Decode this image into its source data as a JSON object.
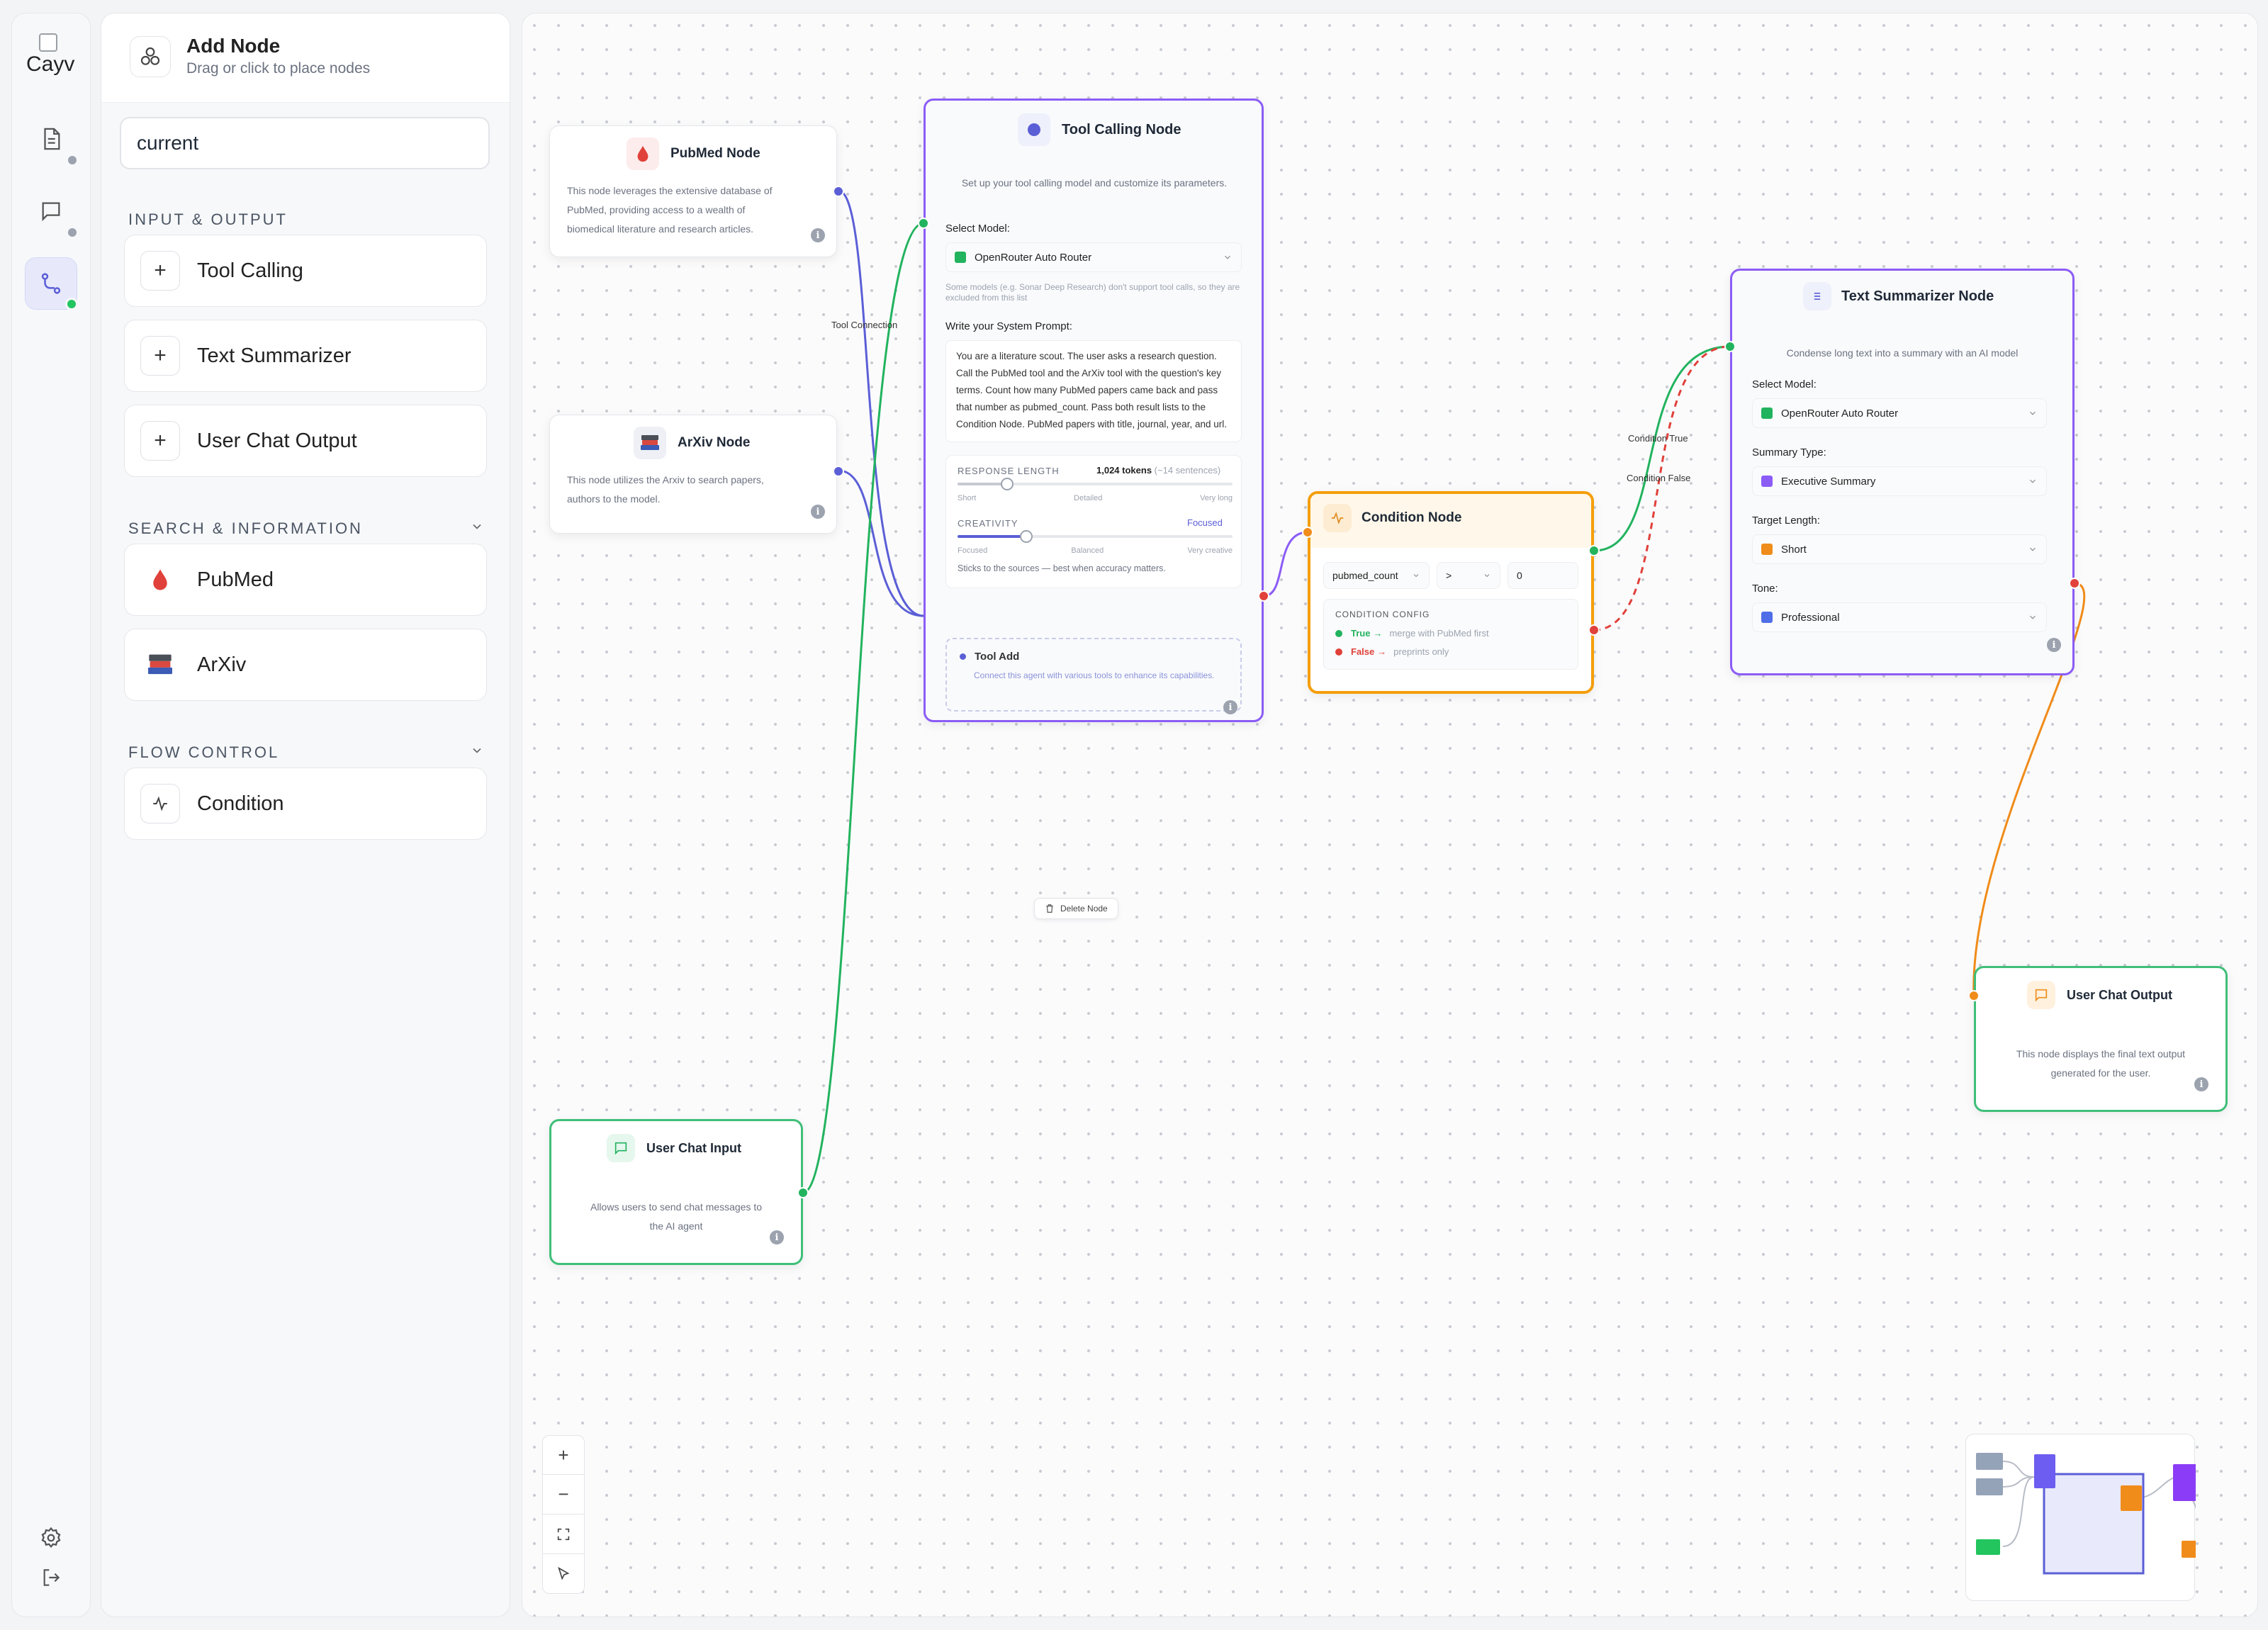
{
  "app": {
    "logo_text": "Cayv"
  },
  "panel": {
    "title": "Add Node",
    "subtitle": "Drag or click to place nodes",
    "search_value": "current",
    "sections": [
      {
        "label": "INPUT & OUTPUT",
        "items": [
          "Tool Calling",
          "Text Summarizer",
          "User Chat Output"
        ]
      },
      {
        "label": "SEARCH & INFORMATION",
        "items": [
          "PubMed",
          "ArXiv"
        ]
      },
      {
        "label": "FLOW CONTROL",
        "items": [
          "Condition"
        ]
      }
    ]
  },
  "nodes": {
    "pubmed": {
      "title": "PubMed Node",
      "desc": [
        "This node leverages the extensive database of",
        "PubMed, providing access to a wealth of",
        "biomedical literature and research articles."
      ]
    },
    "arxiv": {
      "title": "ArXiv Node",
      "desc": [
        "This node utilizes the Arxiv to search papers,",
        "authors to the model."
      ]
    },
    "tool": {
      "title": "Tool Calling Node",
      "subtitle": "Set up your tool calling model and customize its parameters.",
      "model_label": "Select Model:",
      "model_value": "OpenRouter Auto Router",
      "model_note": "Some models (e.g. Sonar Deep Research) don't support tool calls, so they are excluded from this list",
      "prompt_label": "Write your System Prompt:",
      "prompt_text": "You are a literature scout. The user asks a research question. Call the PubMed tool and the ArXiv tool with the question's key terms. Count how many PubMed papers came back and pass that number as pubmed_count. Pass both result lists to the Condition Node. PubMed papers with title, journal, year, and url.",
      "response_label": "RESPONSE LENGTH",
      "response_value": "1,024 tokens",
      "response_note": "(~14 sentences)",
      "response_ticks": [
        "Short",
        "Detailed",
        "Very long"
      ],
      "response_level": 0.18,
      "creativity_label": "CREATIVITY",
      "creativity_value": "Focused",
      "creativity_ticks": [
        "Focused",
        "Balanced",
        "Very creative"
      ],
      "creativity_level": 0.25,
      "creativity_note": "Sticks to the sources — best when accuracy matters.",
      "tool_add_title": "Tool Add",
      "tool_add_desc": "Connect this agent with various tools to enhance its capabilities."
    },
    "condition": {
      "title": "Condition Node",
      "variable": "pubmed_count",
      "operator": ">",
      "value": "0",
      "config_label": "CONDITION CONFIG",
      "true_label": "True",
      "true_text": "merge with PubMed first",
      "false_label": "False",
      "false_text": "preprints only"
    },
    "summarizer": {
      "title": "Text Summarizer Node",
      "subtitle": "Condense long text into a summary with an AI model",
      "model_label": "Select Model:",
      "model_value": "OpenRouter Auto Router",
      "type_label": "Summary Type:",
      "type_value": "Executive Summary",
      "length_label": "Target Length:",
      "length_value": "Short",
      "tone_label": "Tone:",
      "tone_value": "Professional"
    },
    "chat_input": {
      "title": "User Chat Input",
      "desc": [
        "Allows users to send chat messages to",
        "the AI agent"
      ]
    },
    "chat_output": {
      "title": "User Chat Output",
      "desc": [
        "This node displays the final text output",
        "generated for the user."
      ]
    }
  },
  "edge_labels": {
    "tool_connection": "Tool Connection",
    "cond_true": "Condition True",
    "cond_false": "Condition False"
  },
  "delete_node": "Delete Node",
  "controls": {
    "zoom_in": "+",
    "zoom_out": "−"
  },
  "colors": {
    "accent": "#5b5fd6",
    "green": "#22b35e",
    "red": "#e0413a",
    "orange": "#f08c1a",
    "purple": "#8b5cf6"
  }
}
